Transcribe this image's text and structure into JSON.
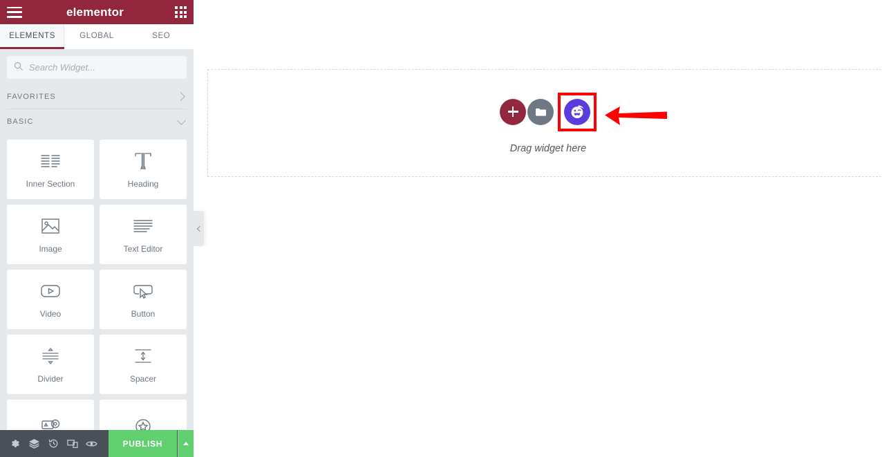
{
  "panel": {
    "header": {
      "menu_icon": "hamburger-icon",
      "brand": "elementor",
      "apps_icon": "apps-grid-icon"
    },
    "tabs": [
      {
        "label": "ELEMENTS",
        "active": true
      },
      {
        "label": "GLOBAL",
        "active": false
      },
      {
        "label": "SEO",
        "active": false
      }
    ],
    "search": {
      "icon": "search-icon",
      "placeholder": "Search Widget...",
      "value": ""
    },
    "categories": [
      {
        "label": "FAVORITES",
        "expanded": false,
        "chevron": "chevron-right-icon"
      },
      {
        "label": "BASIC",
        "expanded": true,
        "chevron": "chevron-down-icon"
      }
    ],
    "widgets": [
      {
        "label": "Inner Section",
        "icon": "inner-section-icon"
      },
      {
        "label": "Heading",
        "icon": "heading-icon"
      },
      {
        "label": "Image",
        "icon": "image-icon"
      },
      {
        "label": "Text Editor",
        "icon": "text-editor-icon"
      },
      {
        "label": "Video",
        "icon": "video-icon"
      },
      {
        "label": "Button",
        "icon": "button-icon"
      },
      {
        "label": "Divider",
        "icon": "divider-icon"
      },
      {
        "label": "Spacer",
        "icon": "spacer-icon"
      },
      {
        "label": "",
        "icon": "google-maps-icon"
      },
      {
        "label": "",
        "icon": "star-rating-icon"
      }
    ],
    "footer": {
      "icons": [
        {
          "name": "settings-gear-icon"
        },
        {
          "name": "navigator-layers-icon"
        },
        {
          "name": "history-icon"
        },
        {
          "name": "responsive-mode-icon"
        },
        {
          "name": "preview-eye-icon"
        }
      ],
      "publish_label": "PUBLISH",
      "publish_color": "#61ce70",
      "caret_icon": "caret-up-icon"
    },
    "collapse_handle": {
      "icon": "chevron-left-icon"
    }
  },
  "canvas": {
    "dropzone": {
      "label": "Drag widget here",
      "buttons": [
        {
          "name": "add-new-section-button",
          "icon": "plus-icon",
          "color": "#92283f"
        },
        {
          "name": "add-template-button",
          "icon": "folder-icon",
          "color": "#6d7882"
        },
        {
          "name": "ai-widget-button",
          "icon": "ai-smiley-icon",
          "color": "#5b3bdd",
          "highlighted": true
        }
      ]
    },
    "annotation": {
      "arrow": "left-arrow-annotation",
      "highlight_color": "#fe0000"
    }
  },
  "colors": {
    "brand_maroon": "#92263c",
    "panel_bg": "#e6e9ec",
    "footer_bg": "#4b4f58",
    "publish_green": "#61ce70",
    "ai_purple": "#5b3bdd",
    "annotation_red": "#fe0000"
  }
}
